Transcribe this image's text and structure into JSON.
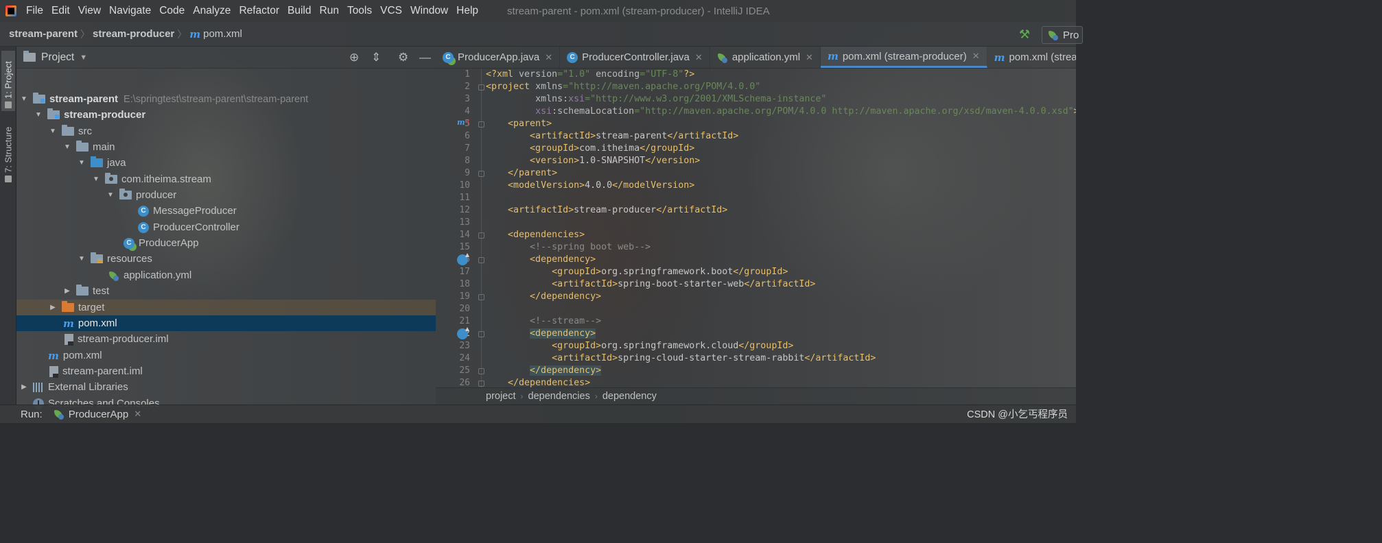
{
  "menu": {
    "items": [
      "File",
      "Edit",
      "View",
      "Navigate",
      "Code",
      "Analyze",
      "Refactor",
      "Build",
      "Run",
      "Tools",
      "VCS",
      "Window",
      "Help"
    ],
    "window_title": "stream-parent - pom.xml (stream-producer) - IntelliJ IDEA"
  },
  "navbar": {
    "crumb1": "stream-parent",
    "crumb2": "stream-producer",
    "file": "pom.xml",
    "m_glyph": "m",
    "run_config": "Pro"
  },
  "leftstrip": {
    "project_tab": "1: Project",
    "structure_tab": "7: Structure"
  },
  "project_panel": {
    "title": "Project",
    "tree": [
      {
        "label": "stream-parent",
        "path": "E:\\springtest\\stream-parent\\stream-parent"
      },
      {
        "label": "stream-producer"
      },
      {
        "label": "src"
      },
      {
        "label": "main"
      },
      {
        "label": "java"
      },
      {
        "label": "com.itheima.stream"
      },
      {
        "label": "producer"
      },
      {
        "label": "MessageProducer"
      },
      {
        "label": "ProducerController"
      },
      {
        "label": "ProducerApp"
      },
      {
        "label": "resources"
      },
      {
        "label": "application.yml"
      },
      {
        "label": "test"
      },
      {
        "label": "target"
      },
      {
        "label": "pom.xml"
      },
      {
        "label": "stream-producer.iml"
      },
      {
        "label": "pom.xml"
      },
      {
        "label": "stream-parent.iml"
      },
      {
        "label": "External Libraries"
      },
      {
        "label": "Scratches and Consoles"
      }
    ]
  },
  "editor": {
    "tabs": [
      {
        "label": "ProducerApp.java"
      },
      {
        "label": "ProducerController.java"
      },
      {
        "label": "application.yml"
      },
      {
        "label": "pom.xml (stream-producer)"
      },
      {
        "label": "pom.xml (stream"
      }
    ],
    "line_numbers": [
      "1",
      "2",
      "3",
      "4",
      "5",
      "6",
      "7",
      "8",
      "9",
      "10",
      "11",
      "12",
      "13",
      "14",
      "15",
      "16",
      "17",
      "18",
      "19",
      "20",
      "21",
      "22",
      "23",
      "24",
      "25",
      "26"
    ],
    "breadcrumb": [
      "project",
      "dependencies",
      "dependency"
    ]
  },
  "runbar": {
    "label": "Run:",
    "tab": "ProducerApp"
  },
  "watermark": "CSDN @小乞丐程序员",
  "icons": {
    "class": "C",
    "maven": "m"
  }
}
